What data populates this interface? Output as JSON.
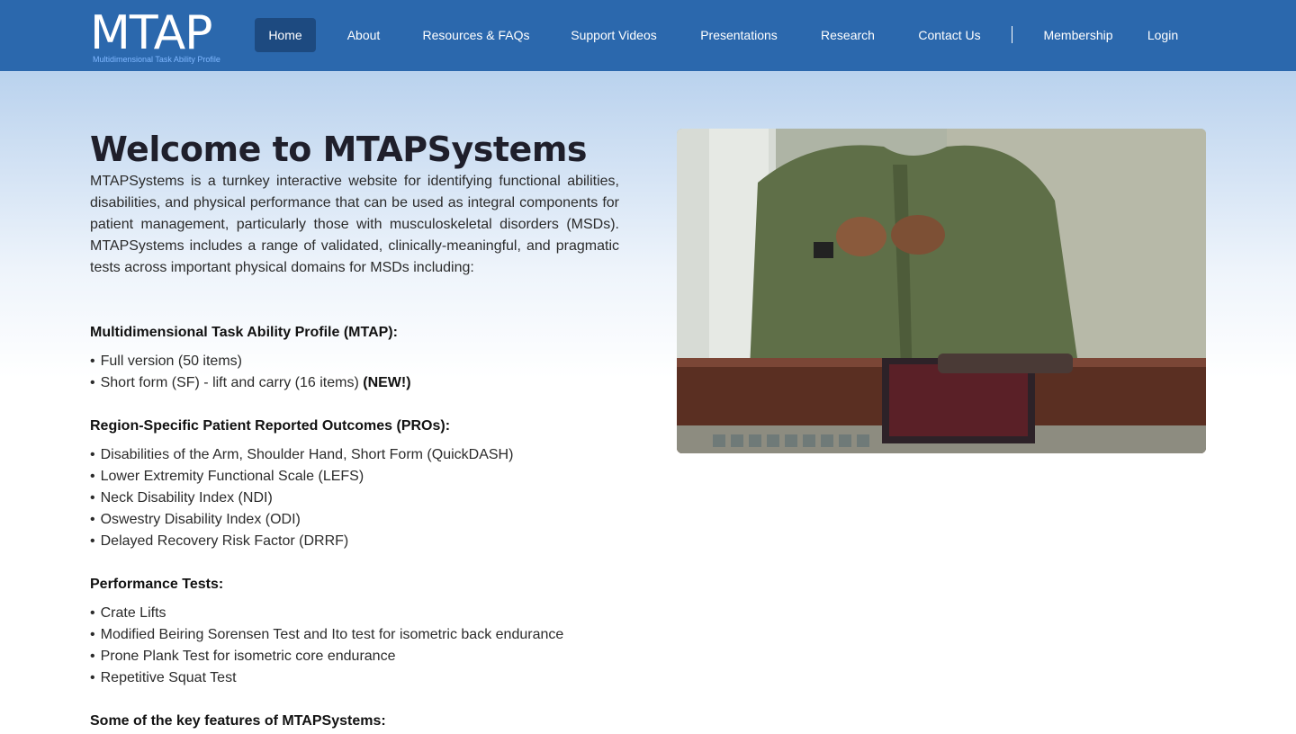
{
  "logo": {
    "text": "MTAP",
    "subtitle": "Multidimensional Task Ability Profile"
  },
  "nav": {
    "items": [
      {
        "label": "Home",
        "active": true
      },
      {
        "label": "About"
      },
      {
        "label": "Resources & FAQs"
      },
      {
        "label": "Support Videos"
      },
      {
        "label": "Presentations"
      },
      {
        "label": "Research"
      },
      {
        "label": "Contact Us"
      },
      {
        "label": "Membership"
      },
      {
        "label": "Login"
      }
    ]
  },
  "hero": {
    "title": "Welcome to MTAPSystems",
    "intro": "MTAPSystems is a turnkey interactive website for identifying functional abilities, disabilities, and physical performance that can be used as integral components for patient management, particularly those with musculoskeletal disorders (MSDs). MTAPSystems includes a range of validated, clinically-meaningful, and pragmatic tests across important physical domains for MSDs including:"
  },
  "sections": [
    {
      "heading": "Multidimensional Task Ability Profile (MTAP):",
      "items": [
        {
          "text": "Full version (50 items)"
        },
        {
          "text": "Short form (SF) - lift and carry (16 items)",
          "badge": "(NEW!)"
        }
      ]
    },
    {
      "heading": "Region-Specific Patient Reported Outcomes (PROs):",
      "items": [
        {
          "text": "Disabilities of the Arm, Shoulder Hand, Short Form (QuickDASH)"
        },
        {
          "text": "Lower Extremity Functional Scale (LEFS)"
        },
        {
          "text": "Neck Disability Index (NDI)"
        },
        {
          "text": "Oswestry Disability Index (ODI)"
        },
        {
          "text": "Delayed Recovery Risk Factor (DRRF)"
        }
      ]
    },
    {
      "heading": "Performance Tests:",
      "items": [
        {
          "text": "Crate Lifts"
        },
        {
          "text": "Modified Beiring Sorensen Test and Ito test for isometric back endurance"
        },
        {
          "text": "Prone Plank Test for isometric core endurance"
        },
        {
          "text": "Repetitive Squat Test"
        }
      ]
    },
    {
      "heading": "Some of the key features of MTAPSystems:",
      "items": []
    }
  ],
  "colors": {
    "navbar": "#2b68ad",
    "nav_active": "#1d4a80",
    "title": "#1f1f2b"
  }
}
